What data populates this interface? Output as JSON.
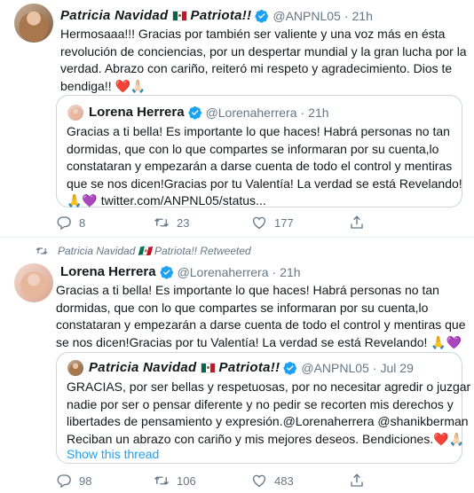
{
  "tweet1": {
    "author_name": "Patricia Navidad",
    "author_badge": "Patriota!!",
    "handle": "@ANPNL05",
    "sep": "·",
    "time": "21h",
    "text_lines": [
      "Hermosaaa!!! Gracias por también ser valiente y una voz más en ésta",
      "revolución de conciencias, por un despertar mundial y la gran lucha por la",
      "verdad.  Abrazo con cariño, reiteró mi respeto y agradecimiento. Dios te",
      "bendiga!! ❤️🙏🏻"
    ],
    "quote": {
      "author_name": "Lorena Herrera",
      "handle": "@Lorenaherrera",
      "sep": "·",
      "time": "21h",
      "text_lines": [
        "Gracias a ti bella! Es importante lo que haces! Habrá personas no tan",
        "dormidas, que con lo que compartes se informaran por su cuenta,lo",
        "constataran y empezarán a darse cuenta de todo el control y mentiras",
        "que se nos dicen!Gracias por tu Valentía! La verdad se está Revelando!",
        "🙏💜 twitter.com/ANPNL05/status..."
      ]
    },
    "replies": "8",
    "retweets": "23",
    "likes": "177"
  },
  "tweet2": {
    "social_context": "Patricia Navidad 🇲🇽 Patriota!! Retweeted",
    "author_name": "Lorena Herrera",
    "handle": "@Lorenaherrera",
    "sep": "·",
    "time": "21h",
    "text_lines": [
      "Gracias a ti bella! Es importante lo que haces! Habrá personas no tan",
      "dormidas, que con lo que compartes se informaran por su cuenta,lo",
      "constataran y empezarán a darse cuenta de todo el control y mentiras que",
      "se nos dicen!Gracias por tu Valentía! La verdad se está Revelando! 🙏💜"
    ],
    "quote": {
      "author_name": "Patricia Navidad",
      "author_badge": "Patriota!!",
      "handle": "@ANPNL05",
      "sep": "·",
      "time": "Jul 29",
      "text_lines": [
        "GRACIAS, por ser bellas y respetuosas, por no necesitar agredir o juzgar a",
        "nadie por ser o pensar diferente y no pedir se recorten mis derechos y",
        "libertades de pensamiento y expresión.@Lorenaherrera @shanikberman",
        "Reciban un abrazo con cariño y mis mejores deseos. Bendiciones.❤️🙏🏻"
      ],
      "show_thread": "Show this thread"
    },
    "replies": "98",
    "retweets": "106",
    "likes": "483"
  },
  "icons": {
    "flag": "mexico-flag",
    "verified": "verified-badge",
    "reply": "reply-icon",
    "retweet": "retweet-icon",
    "like": "like-icon"
  },
  "colors": {
    "verified": "#1da1f2",
    "link": "#1da1f2",
    "muted": "#657786",
    "border": "#ccd6dd"
  }
}
